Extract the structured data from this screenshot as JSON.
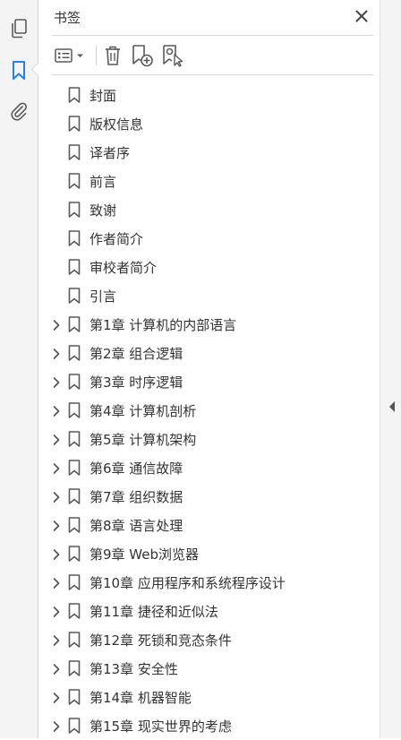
{
  "panel": {
    "title": "书签"
  },
  "toolbar": {
    "options_icon": "list-options-icon",
    "delete_icon": "trash-icon",
    "new_bookmark_icon": "bookmark-add-icon",
    "find_bookmark_icon": "bookmark-search-icon"
  },
  "rail": {
    "icons": [
      "pages-icon",
      "bookmark-icon",
      "attachment-icon"
    ],
    "active": "bookmark-icon"
  },
  "bookmarks": [
    {
      "label": "封面",
      "expandable": false
    },
    {
      "label": "版权信息",
      "expandable": false
    },
    {
      "label": "译者序",
      "expandable": false
    },
    {
      "label": "前言",
      "expandable": false
    },
    {
      "label": "致谢",
      "expandable": false
    },
    {
      "label": "作者简介",
      "expandable": false
    },
    {
      "label": "审校者简介",
      "expandable": false
    },
    {
      "label": "引言",
      "expandable": false
    },
    {
      "label": "第1章 计算机的内部语言",
      "expandable": true
    },
    {
      "label": "第2章 组合逻辑",
      "expandable": true
    },
    {
      "label": "第3章 时序逻辑",
      "expandable": true
    },
    {
      "label": "第4章 计算机剖析",
      "expandable": true
    },
    {
      "label": "第5章 计算机架构",
      "expandable": true
    },
    {
      "label": "第6章 通信故障",
      "expandable": true
    },
    {
      "label": "第7章 组织数据",
      "expandable": true
    },
    {
      "label": "第8章 语言处理",
      "expandable": true
    },
    {
      "label": "第9章 Web浏览器",
      "expandable": true
    },
    {
      "label": "第10章 应用程序和系统程序设计",
      "expandable": true
    },
    {
      "label": "第11章 捷径和近似法",
      "expandable": true
    },
    {
      "label": "第12章 死锁和竞态条件",
      "expandable": true
    },
    {
      "label": "第13章 安全性",
      "expandable": true
    },
    {
      "label": "第14章 机器智能",
      "expandable": true
    },
    {
      "label": "第15章 现实世界的考虑",
      "expandable": true
    }
  ],
  "colors": {
    "accent": "#2680eb",
    "icon": "#5a5a5a",
    "rail_bg": "#f4f4f4"
  }
}
